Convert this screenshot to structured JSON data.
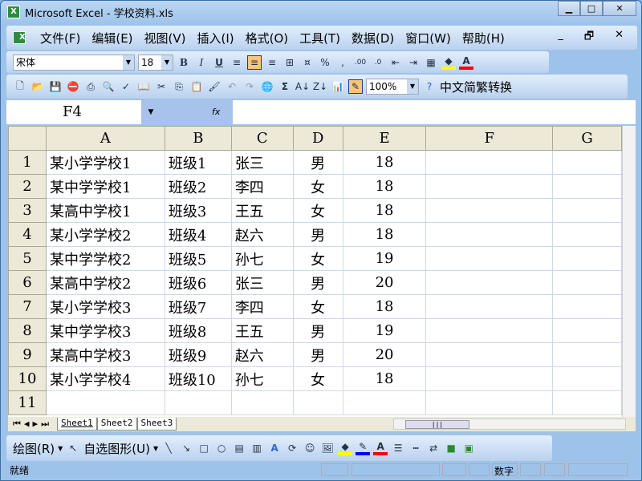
{
  "window": {
    "title": "Microsoft Excel - 学校资料.xls",
    "min": "▁",
    "max": "□",
    "close": "✕"
  },
  "menu": [
    "文件(F)",
    "编辑(E)",
    "视图(V)",
    "插入(I)",
    "格式(O)",
    "工具(T)",
    "数据(D)",
    "窗口(W)",
    "帮助(H)"
  ],
  "doc_controls": [
    "_",
    "🗗",
    "✕"
  ],
  "format_toolbar": {
    "font": "宋体",
    "size": "18",
    "bold": "B",
    "italic": "I",
    "underline": "U",
    "percent": "%",
    "comma": ",",
    "fill_color": "#ffff00",
    "font_color": "#ff0000"
  },
  "standard_toolbar": {
    "zoom": "100%",
    "sigma": "Σ",
    "convert": "中文简繁转换"
  },
  "formula_bar": {
    "name_box": "F4",
    "fx": "fx",
    "value": ""
  },
  "columns": [
    "A",
    "B",
    "C",
    "D",
    "E",
    "F",
    "G"
  ],
  "rows": [
    [
      "某小学学校1",
      "班级1",
      "张三",
      "男",
      "18"
    ],
    [
      "某中学学校1",
      "班级2",
      "李四",
      "女",
      "18"
    ],
    [
      "某高中学校1",
      "班级3",
      "王五",
      "女",
      "18"
    ],
    [
      "某小学学校2",
      "班级4",
      "赵六",
      "男",
      "18"
    ],
    [
      "某中学学校2",
      "班级5",
      "孙七",
      "女",
      "19"
    ],
    [
      "某高中学校2",
      "班级6",
      "张三",
      "男",
      "20"
    ],
    [
      "某小学学校3",
      "班级7",
      "李四",
      "女",
      "18"
    ],
    [
      "某中学学校3",
      "班级8",
      "王五",
      "男",
      "19"
    ],
    [
      "某高中学校3",
      "班级9",
      "赵六",
      "男",
      "20"
    ],
    [
      "某小学学校4",
      "班级10",
      "孙七",
      "女",
      "18"
    ],
    [
      "",
      "",
      "",
      "",
      ""
    ]
  ],
  "sheets": [
    "Sheet1",
    "Sheet2",
    "Sheet3"
  ],
  "drawing_toolbar": {
    "draw": "绘图(R)",
    "autoshapes": "自选图形(U)"
  },
  "status": {
    "left": "就绪",
    "num": "数字"
  }
}
